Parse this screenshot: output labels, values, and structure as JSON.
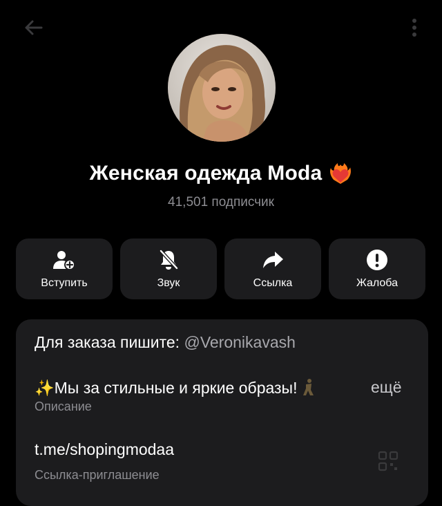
{
  "header": {
    "back_icon": "arrow-left-icon",
    "menu_icon": "more-vertical-icon"
  },
  "channel": {
    "title": "Женская одежда Moda",
    "title_emoji": "burning-heart-icon",
    "subscribers": "41,501 подписчик"
  },
  "actions": [
    {
      "label": "Вступить",
      "icon": "add-user-icon"
    },
    {
      "label": "Звук",
      "icon": "bell-muted-icon"
    },
    {
      "label": "Ссылка",
      "icon": "share-arrow-icon"
    },
    {
      "label": "Жалоба",
      "icon": "alert-circle-icon"
    }
  ],
  "info": {
    "order_prefix": "Для заказа пишите: ",
    "order_handle": "@Veronikavash",
    "description_sparkle": "✨",
    "description_text": "Мы за стильные и яркие образы! ",
    "description_more": "ещё",
    "description_label": "Описание",
    "invite_link": "t.me/shopingmodaa",
    "invite_label": "Ссылка-приглашение",
    "qr_icon": "qr-code-icon"
  },
  "colors": {
    "background": "#000000",
    "card": "#1c1c1e",
    "secondary_text": "#8d8d92"
  }
}
